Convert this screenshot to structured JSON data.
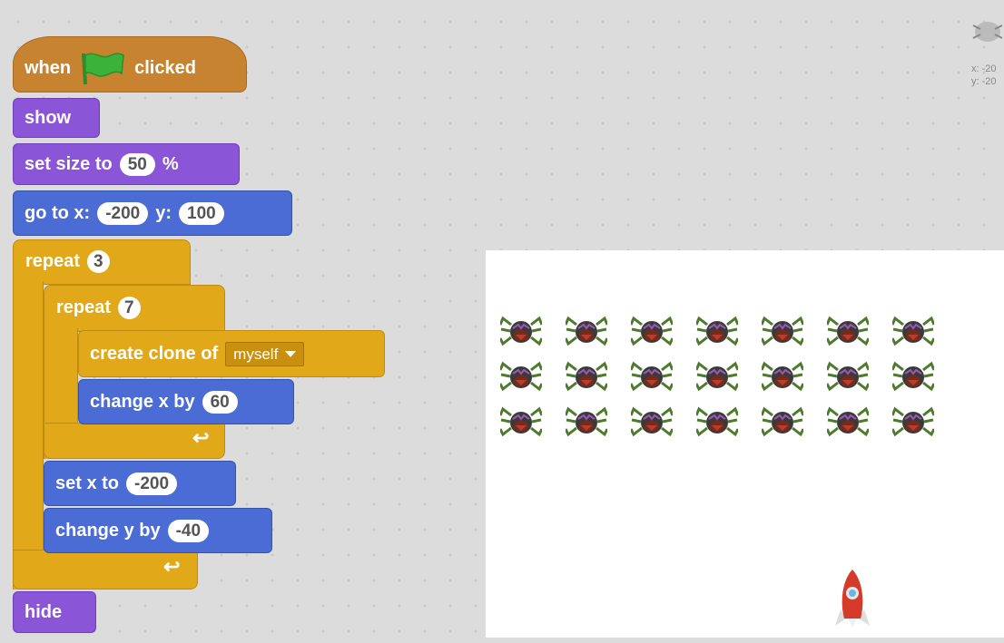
{
  "script": {
    "hat": {
      "left": "when",
      "right": "clicked",
      "flag_icon": "green-flag-icon"
    },
    "show": "show",
    "set_size": {
      "label": "set size to",
      "value": "50",
      "unit": "%"
    },
    "goto": {
      "label": "go to x:",
      "x": "-200",
      "y_label": "y:",
      "y": "100"
    },
    "repeat_outer": {
      "label": "repeat",
      "count": "3"
    },
    "repeat_inner": {
      "label": "repeat",
      "count": "7"
    },
    "create_clone": {
      "label": "create clone of",
      "option": "myself"
    },
    "change_x": {
      "label": "change x by",
      "value": "60"
    },
    "set_x": {
      "label": "set x to",
      "value": "-200"
    },
    "change_y": {
      "label": "change y by",
      "value": "-40"
    },
    "hide": "hide",
    "loop_arrow": "↩"
  },
  "sprite_info": {
    "x": "x: -20",
    "y": "y: -20"
  },
  "stage": {
    "clone_rows": 3,
    "clone_cols": 7,
    "clone_icon": "spider-icon",
    "player_icon": "rocket-icon"
  },
  "colors": {
    "events": "#c88330",
    "looks": "#8a55d7",
    "motion": "#4a6cd4",
    "control": "#e1a91a"
  }
}
